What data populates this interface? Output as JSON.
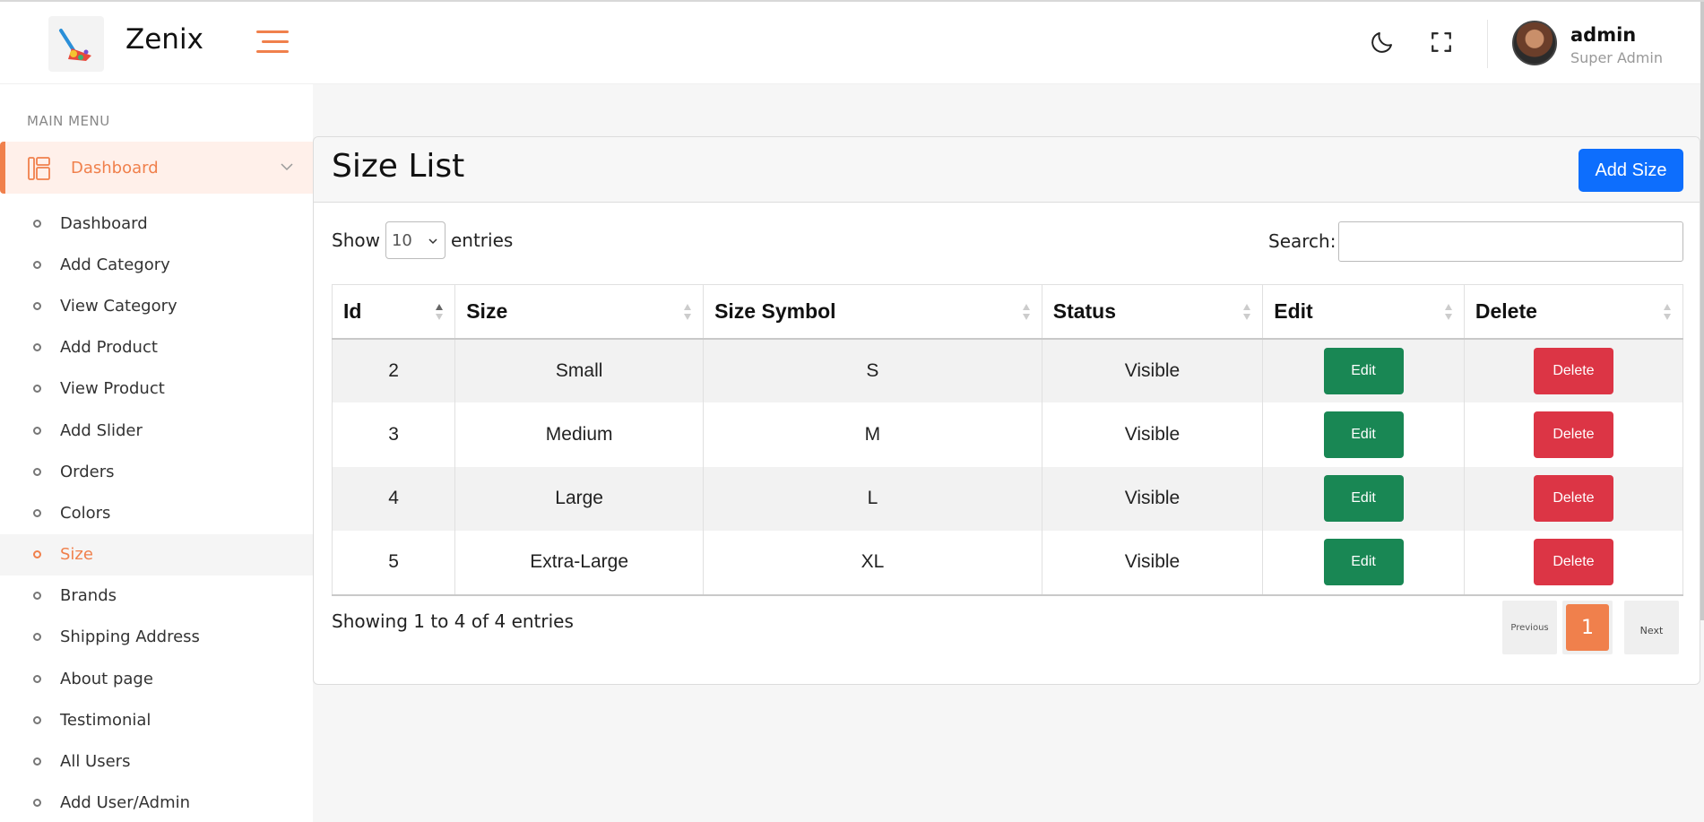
{
  "header": {
    "brand": "Zenix",
    "user_name": "admin",
    "user_role": "Super Admin"
  },
  "sidebar": {
    "section_label": "MAIN MENU",
    "main_item": "Dashboard",
    "items": [
      {
        "label": "Dashboard"
      },
      {
        "label": "Add Category"
      },
      {
        "label": "View Category"
      },
      {
        "label": "Add Product"
      },
      {
        "label": "View Product"
      },
      {
        "label": "Add Slider"
      },
      {
        "label": "Orders"
      },
      {
        "label": "Colors"
      },
      {
        "label": "Size"
      },
      {
        "label": "Brands"
      },
      {
        "label": "Shipping Address"
      },
      {
        "label": "About page"
      },
      {
        "label": "Testimonial"
      },
      {
        "label": "All Users"
      },
      {
        "label": "Add User/Admin"
      }
    ],
    "active_index": 8
  },
  "page": {
    "title": "Size List",
    "add_button": "Add Size",
    "show_label": "Show",
    "entries_value": "10",
    "entries_label": "entries",
    "search_label": "Search:",
    "search_value": "",
    "showing_text": "Showing 1 to 4 of 4 entries",
    "pager_prev": "Previous",
    "pager_current": "1",
    "pager_next": "Next"
  },
  "table": {
    "columns": [
      "Id",
      "Size",
      "Size Symbol",
      "Status",
      "Edit",
      "Delete"
    ],
    "rows": [
      {
        "id": "2",
        "size": "Small",
        "symbol": "S",
        "status": "Visible",
        "edit": "Edit",
        "delete": "Delete"
      },
      {
        "id": "3",
        "size": "Medium",
        "symbol": "M",
        "status": "Visible",
        "edit": "Edit",
        "delete": "Delete"
      },
      {
        "id": "4",
        "size": "Large",
        "symbol": "L",
        "status": "Visible",
        "edit": "Edit",
        "delete": "Delete"
      },
      {
        "id": "5",
        "size": "Extra-Large",
        "symbol": "XL",
        "status": "Visible",
        "edit": "Edit",
        "delete": "Delete"
      }
    ]
  },
  "colors": {
    "accent": "#f0804c",
    "primary": "#0d6efd",
    "success": "#198754",
    "danger": "#dc3545"
  },
  "icons": {
    "theme_toggle": "moon-icon",
    "fullscreen": "fullscreen-icon",
    "menu": "hamburger-icon",
    "dashboard": "dashboard-layout-icon"
  }
}
